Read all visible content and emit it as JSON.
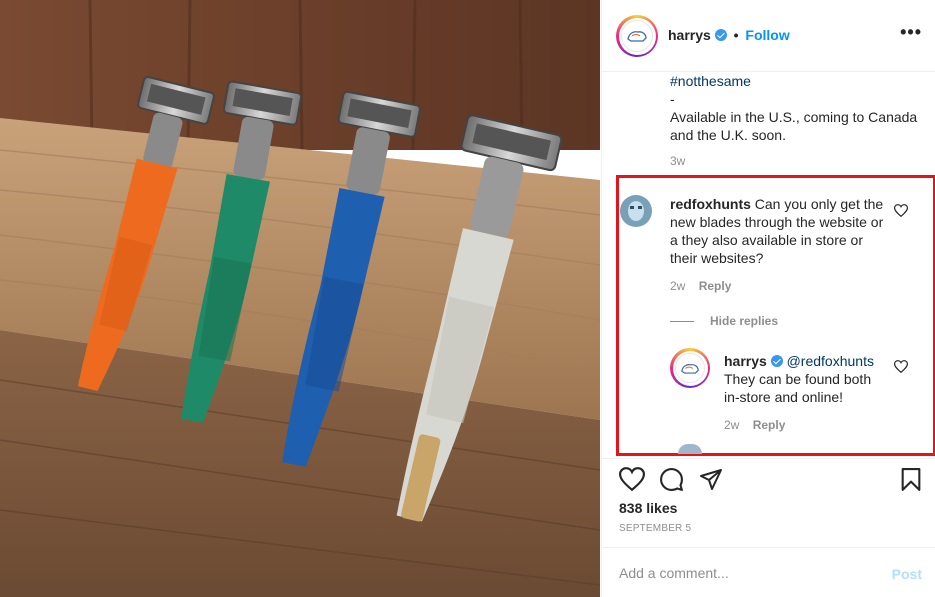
{
  "post_author": {
    "username": "harrys",
    "verified": true,
    "separator": "•",
    "follow_label": "Follow",
    "more_icon": "more-dots-icon",
    "more_glyph": "•••"
  },
  "caption": {
    "hashtag": "#notthesame",
    "dash": "-",
    "text": "Available in the U.S., coming to Canada and the U.K. soon.",
    "time": "3w"
  },
  "comments": [
    {
      "username": "redfoxhunts",
      "text": "Can you only get the new blades through the website or a they also available in store or their websites?",
      "time": "2w",
      "reply_label": "Reply",
      "hide_replies_label": "Hide replies"
    }
  ],
  "reply": {
    "username": "harrys",
    "verified": true,
    "mention": "@redfoxhunts",
    "text": "They can be found both in-store and online!",
    "time": "2w",
    "reply_label": "Reply"
  },
  "actions": {
    "like_icon": "heart-icon",
    "comment_icon": "comment-icon",
    "share_icon": "share-icon",
    "save_icon": "bookmark-icon"
  },
  "likes": "838 likes",
  "date": "SEPTEMBER 5",
  "comment_box": {
    "placeholder": "Add a comment...",
    "post_label": "Post"
  },
  "colors": {
    "highlight": "#e3141c",
    "link": "#0095f6",
    "mention": "#00376b",
    "razor_orange": "#ee6a1f",
    "razor_green": "#1f8a68",
    "razor_blue": "#1f5fb0",
    "razor_white": "#d8d8d2"
  }
}
